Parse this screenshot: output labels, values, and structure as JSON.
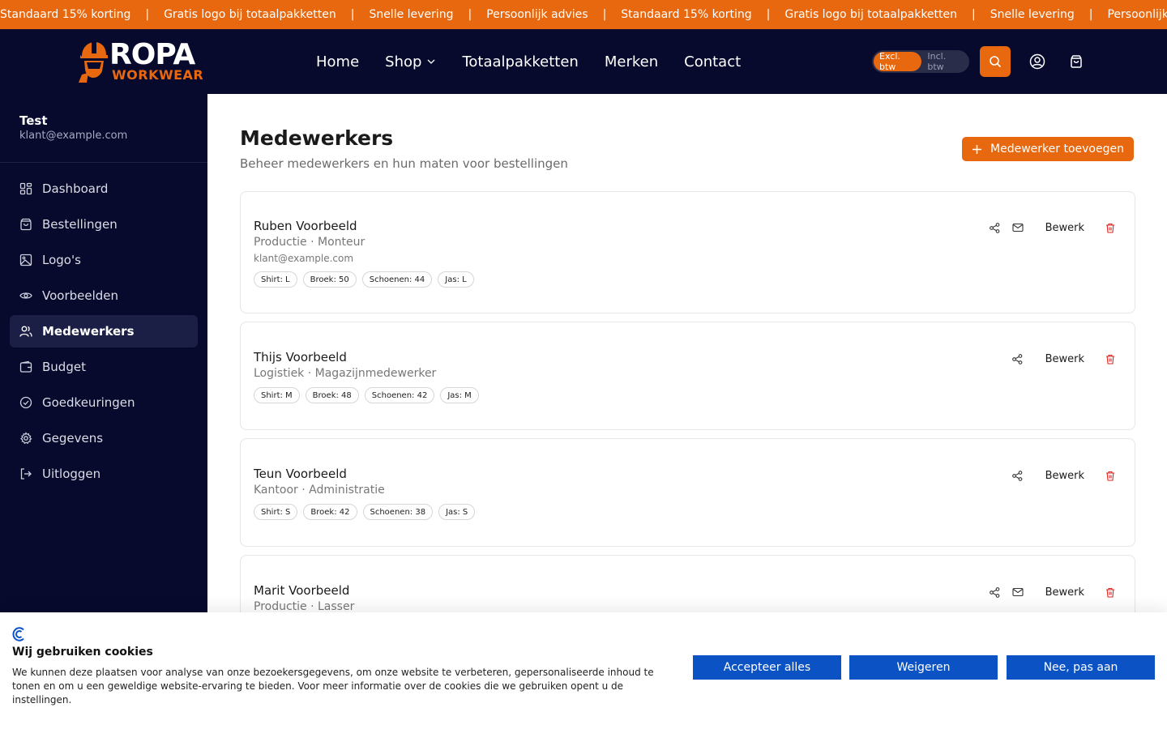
{
  "ticker": {
    "items": [
      "Standaard 15% korting",
      "Gratis logo bij totaalpakketten",
      "Snelle levering",
      "Persoonlijk advies",
      "Standaard 15% korting",
      "Gratis logo bij totaalpakketten",
      "Snelle levering",
      "Persoonlijk"
    ],
    "separator": "|"
  },
  "header": {
    "logo_top": "ROPA",
    "logo_bottom": "WORKWEAR",
    "nav": [
      "Home",
      "Shop",
      "Totaalpakketten",
      "Merken",
      "Contact"
    ],
    "vat_excl": "Excl. btw",
    "vat_incl": "Incl. btw",
    "colors": {
      "brand": "#e8680f",
      "header_bg": "#070a2d"
    }
  },
  "sidebar": {
    "user_name": "Test",
    "user_email": "klant@example.com",
    "items": [
      {
        "label": "Dashboard",
        "icon": "dashboard-icon"
      },
      {
        "label": "Bestellingen",
        "icon": "shopping-bag-icon"
      },
      {
        "label": "Logo's",
        "icon": "image-icon"
      },
      {
        "label": "Voorbeelden",
        "icon": "eye-icon"
      },
      {
        "label": "Medewerkers",
        "icon": "users-icon",
        "active": true
      },
      {
        "label": "Budget",
        "icon": "wallet-icon"
      },
      {
        "label": "Goedkeuringen",
        "icon": "check-circle-icon"
      },
      {
        "label": "Gegevens",
        "icon": "gear-icon"
      },
      {
        "label": "Uitloggen",
        "icon": "logout-icon"
      }
    ]
  },
  "main": {
    "title": "Medewerkers",
    "subtitle": "Beheer medewerkers en hun maten voor bestellingen",
    "add_button": "Medewerker toevoegen",
    "edit_label": "Bewerk",
    "employees": [
      {
        "name": "Ruben Voorbeeld",
        "dept": "Productie · Monteur",
        "email": "klant@example.com",
        "sizes": [
          "Shirt: L",
          "Broek: 50",
          "Schoenen: 44",
          "Jas: L"
        ]
      },
      {
        "name": "Thijs Voorbeeld",
        "dept": "Logistiek · Magazijnmedewerker",
        "sizes": [
          "Shirt: M",
          "Broek: 48",
          "Schoenen: 42",
          "Jas: M"
        ]
      },
      {
        "name": "Teun Voorbeeld",
        "dept": "Kantoor · Administratie",
        "sizes": [
          "Shirt: S",
          "Broek: 42",
          "Schoenen: 38",
          "Jas: S"
        ]
      },
      {
        "name": "Marit Voorbeeld",
        "dept": "Productie · Lasser"
      }
    ]
  },
  "cookie": {
    "title": "Wij gebruiken cookies",
    "text": "We kunnen deze plaatsen voor analyse van onze bezoekersgegevens, om onze website te verbeteren, gepersonaliseerde inhoud te tonen en om u een geweldige website-ervaring te bieden. Voor meer informatie over de cookies die we gebruiken opent u de instellingen.",
    "accept": "Accepteer alles",
    "reject": "Weigeren",
    "customize": "Nee, pas aan"
  }
}
